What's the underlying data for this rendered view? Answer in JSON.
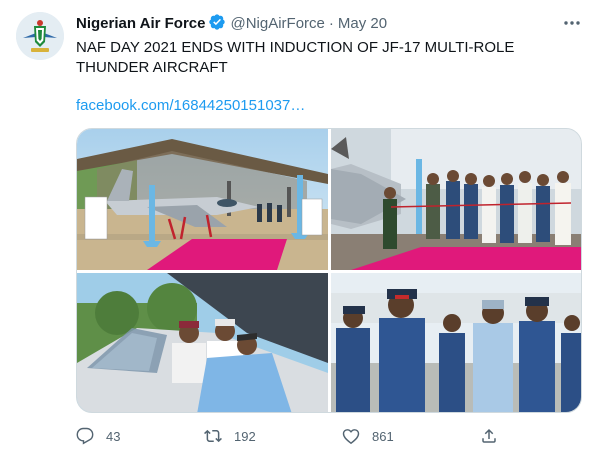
{
  "author": {
    "name": "Nigerian Air Force",
    "handle": "@NigAirForce",
    "separator": "·",
    "date": "May 20",
    "verified": true,
    "avatar_icon": "naf-crest-icon"
  },
  "tweet": {
    "line1": "NAF DAY 2021 ENDS WITH INDUCTION OF JF-17 MULTI-ROLE",
    "line2": "THUNDER AIRCRAFT",
    "link": "facebook.com/16844250151037…"
  },
  "media": {
    "photos": [
      {
        "name": "jf17-under-canopy"
      },
      {
        "name": "ribbon-cutting-ceremony"
      },
      {
        "name": "cockpit-inspection"
      },
      {
        "name": "officers-walking"
      }
    ]
  },
  "actions": {
    "replies": "43",
    "retweets": "192",
    "likes": "861"
  },
  "colors": {
    "text": "#0f1419",
    "secondary": "#536471",
    "link": "#1d9bf0",
    "verified": "#1d9bf0",
    "border": "#cfd9de"
  }
}
